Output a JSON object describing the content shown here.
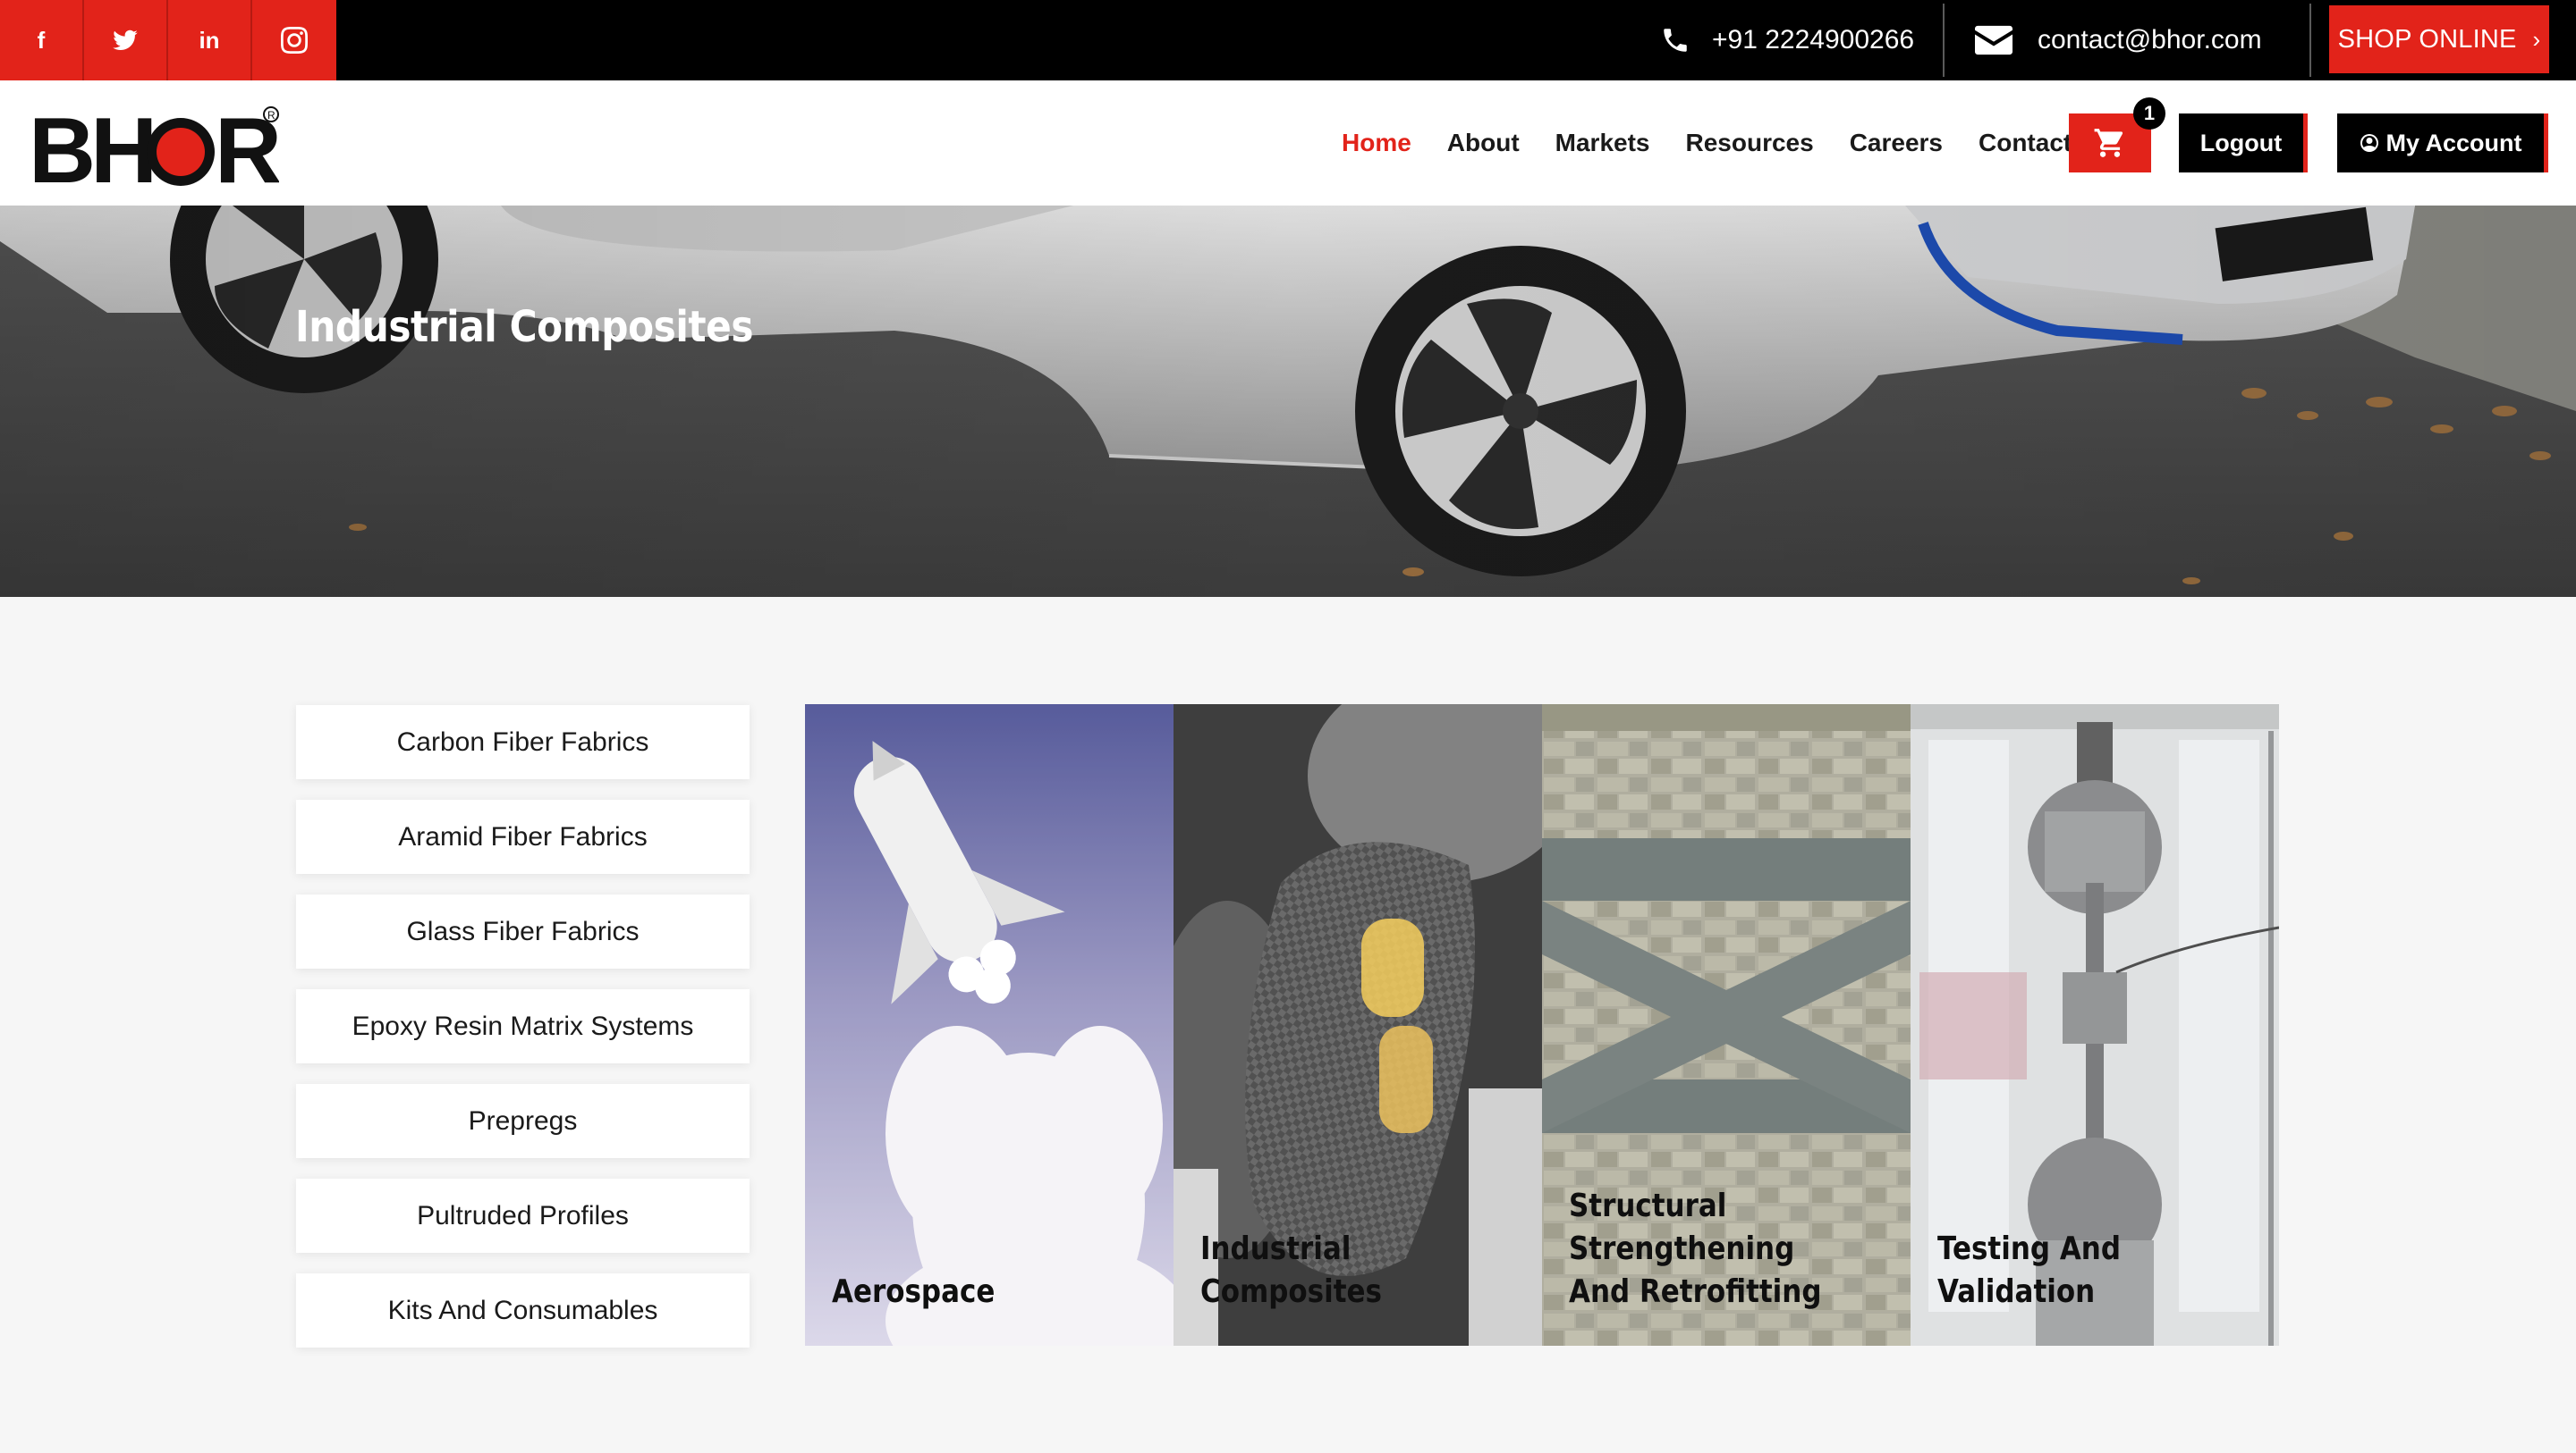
{
  "topbar": {
    "social": [
      {
        "icon": "facebook-icon",
        "glyph": "f"
      },
      {
        "icon": "twitter-icon",
        "glyph": ""
      },
      {
        "icon": "linkedin-icon",
        "glyph": "in"
      },
      {
        "icon": "instagram-icon",
        "glyph": ""
      }
    ],
    "phone": "+91 2224900266",
    "email": "contact@bhor.com",
    "shop_label": "SHOP ONLINE",
    "shop_chevron": "›"
  },
  "brand": {
    "logo_text": "BHOR",
    "registered": "®",
    "red": "#e2231a"
  },
  "nav": {
    "items": [
      "Home",
      "About",
      "Markets",
      "Resources",
      "Careers",
      "Contact"
    ],
    "active": "Home",
    "cart_count": "1",
    "logout_label": "Logout",
    "account_label": "My Account"
  },
  "hero": {
    "title": "Industrial Composites"
  },
  "sidebar": {
    "items": [
      "Carbon Fiber Fabrics",
      "Aramid Fiber Fabrics",
      "Glass Fiber Fabrics",
      "Epoxy Resin Matrix Systems",
      "Prepregs",
      "Pultruded Profiles",
      "Kits And Consumables"
    ]
  },
  "cards": [
    {
      "label": "Aerospace"
    },
    {
      "label": "Industrial Composites"
    },
    {
      "label": "Structural Strengthening And Retrofitting"
    },
    {
      "label": "Testing And Validation"
    }
  ]
}
